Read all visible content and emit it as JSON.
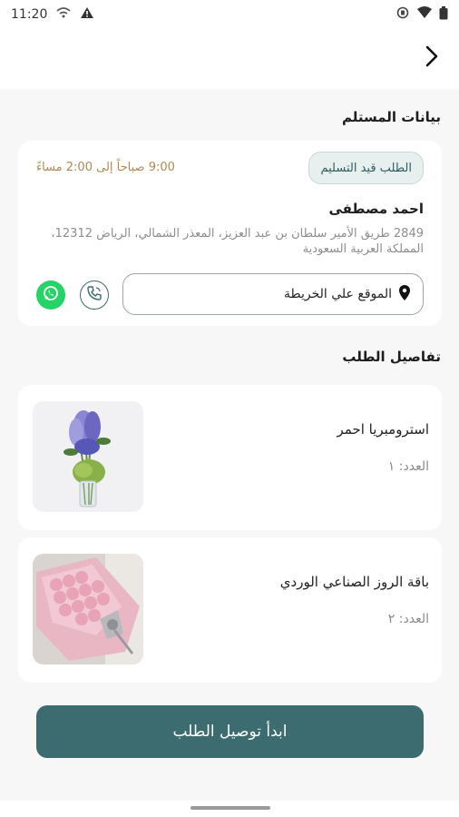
{
  "status_bar": {
    "time": "11:20"
  },
  "sections": {
    "recipient_title": "بيانات المستلم",
    "order_details_title": "تفاصيل الطلب"
  },
  "recipient": {
    "status": "الطلب قيد التسليم",
    "time_window": "9:00 صباحاً إلى 2:00 مساءً",
    "name": "احمد مصطفى",
    "address": "2849 طريق الأمير سلطان بن عبد العزيز، المعذر الشمالي، الرياض 12312، المملكة العربية السعودية",
    "map_label": "الموقع علي الخريطة"
  },
  "products": [
    {
      "name": "استرومبريا احمر",
      "qty": "العدد: ١"
    },
    {
      "name": "باقة الروز الصناعي الوردي",
      "qty": "العدد: ٢"
    }
  ],
  "actions": {
    "start_delivery": "ابدأ توصيل الطلب"
  },
  "colors": {
    "accent": "#3c6c6f",
    "time_text": "#b08a52",
    "whatsapp": "#25d366",
    "background": "#f7f7f7"
  },
  "icons": {
    "back": "chevron-right-icon",
    "map": "location-pin-icon",
    "phone": "phone-icon",
    "whatsapp": "whatsapp-icon"
  }
}
